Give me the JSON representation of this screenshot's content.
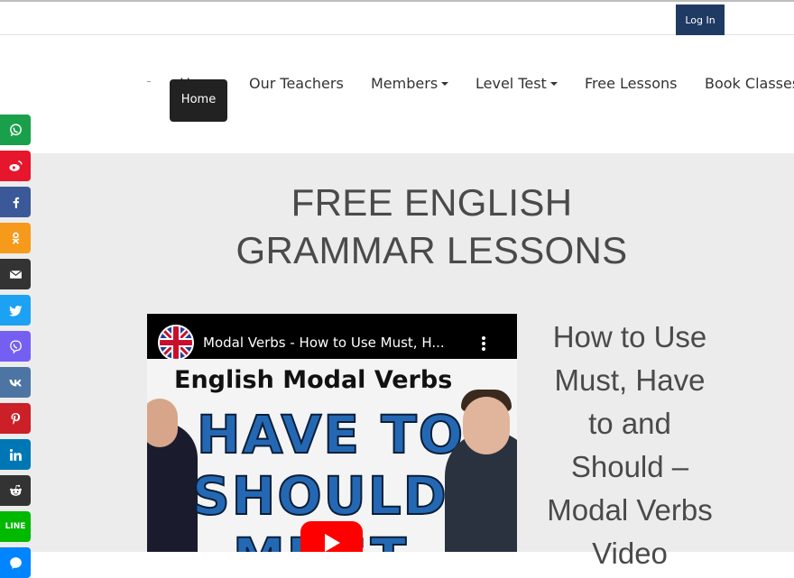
{
  "topbar": {
    "login_label": "Log In"
  },
  "nav": {
    "items": [
      {
        "label": "Home"
      },
      {
        "label": "Our Teachers"
      },
      {
        "label": "Members"
      },
      {
        "label": "Level Test"
      },
      {
        "label": "Free Lessons"
      },
      {
        "label": "Book Classes"
      }
    ],
    "home_tooltip": "Home"
  },
  "hero": {
    "line1": "FREE ENGLISH",
    "line2": "GRAMMAR LESSONS"
  },
  "video": {
    "title": "Modal Verbs - How to Use Must, H...",
    "thumb_heading": "English Modal Verbs",
    "thumb_words": [
      "HAVE TO",
      "SHOULD",
      "MUST"
    ]
  },
  "lesson": {
    "title": "How to Use Must, Have to and Should – Modal Verbs Video"
  },
  "share_bar": {
    "buttons": [
      {
        "icon": "whatsapp-icon",
        "color": "#1aa04a",
        "label": "WhatsApp"
      },
      {
        "icon": "weibo-icon",
        "color": "#e6162d",
        "label": "Weibo"
      },
      {
        "icon": "facebook-icon",
        "color": "#3b5998",
        "label": "Facebook"
      },
      {
        "icon": "odnoklassniki-icon",
        "color": "#f59a1b",
        "label": "Odnoklassniki"
      },
      {
        "icon": "email-icon",
        "color": "#333333",
        "label": "Email"
      },
      {
        "icon": "twitter-icon",
        "color": "#1da1f2",
        "label": "Twitter"
      },
      {
        "icon": "viber-icon",
        "color": "#7360f2",
        "label": "Viber"
      },
      {
        "icon": "vk-icon",
        "color": "#4c75a3",
        "label": "VK"
      },
      {
        "icon": "pinterest-icon",
        "color": "#cb2027",
        "label": "Pinterest"
      },
      {
        "icon": "linkedin-icon",
        "color": "#0077b5",
        "label": "LinkedIn"
      },
      {
        "icon": "reddit-icon",
        "color": "#333333",
        "label": "Reddit"
      },
      {
        "icon": "line-icon",
        "color": "#00b900",
        "label": "LINE"
      },
      {
        "icon": "messenger-icon",
        "color": "#0084ff",
        "label": "Messenger"
      }
    ],
    "line_text": "LINE"
  }
}
